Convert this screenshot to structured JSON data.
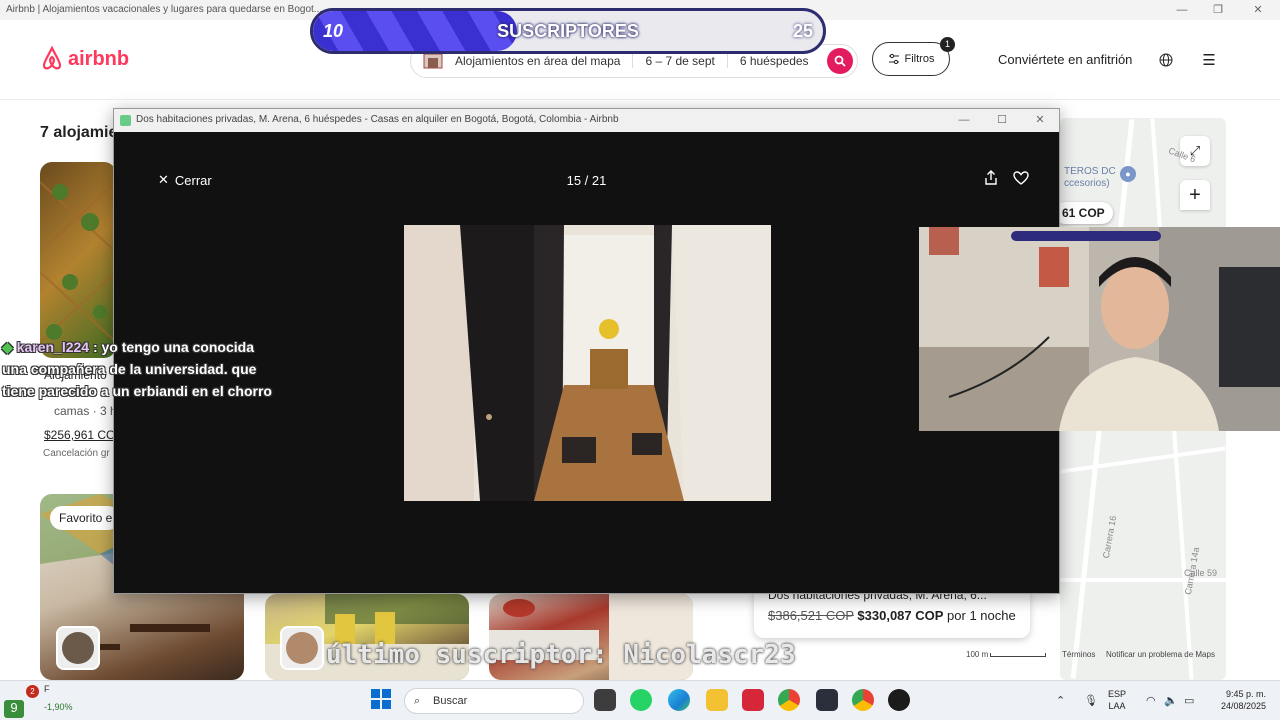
{
  "browser": {
    "title": "Airbnb | Alojamientos vacacionales y lugares para quedarse en Bogot..."
  },
  "header": {
    "logo": "airbnb",
    "search_segments": [
      "Alojamientos en área del mapa",
      "6 – 7 de sept",
      "6 huéspedes"
    ],
    "filters_label": "Filtros",
    "filters_count": "1",
    "host_link": "Conviértete en anfitrión"
  },
  "subscriber_bar": {
    "current": "10",
    "label": "SUSCRIPTORES",
    "goal": "25",
    "progress": 0.4
  },
  "listings": {
    "results": "7 alojamie",
    "card1": {
      "title": "Alojamiento",
      "subtitle": "camas · 3 h",
      "price": "$256,961 CO",
      "cancel": "Cancelación gr"
    },
    "favorite_badge": "Favorito e"
  },
  "map": {
    "poi": "TEROS DC\nccesorios)",
    "price_pin": "61 COP",
    "streets": [
      "Calle 6",
      "Carrera 16",
      "Calle 59",
      "Carrera 14a"
    ],
    "scale": "100 m",
    "terms": "Términos",
    "report": "Notificar un problema de Maps",
    "popup": {
      "title": "Dos habitaciones privadas, M. Arena, 6...",
      "old_price": "$386,521 COP",
      "new_price": "$330,087 COP",
      "per": "por 1 noche"
    }
  },
  "viewer": {
    "title": "Dos habitaciones privadas, M. Arena, 6 huéspedes - Casas en alquiler en Bogotá, Bogotá, Colombia - Airbnb",
    "close_label": "Cerrar",
    "counter": "15 / 21"
  },
  "chat": {
    "user": "karen_l224",
    "message": ": yo tengo una conocida una compañera de la universidad. que tiene parecido a un erbiandi en el chorro"
  },
  "overlay": {
    "last_subscriber": "último suscriptor: Nicolascr23"
  },
  "taskbar": {
    "weather_text": "F",
    "weather_value": "-1,90%",
    "notif_count": "2",
    "search_placeholder": "Buscar",
    "lang_line1": "ESP",
    "lang_line2": "LAA",
    "time": "9:45 p. m.",
    "date": "24/08/2025"
  },
  "colors": {
    "airbnb_red": "#ff385c",
    "search_pink": "#e31c5f",
    "sub_bar_fill": "#3a2fd0"
  }
}
